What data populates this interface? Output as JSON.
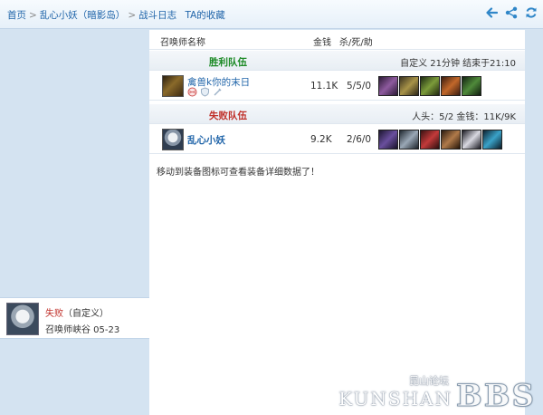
{
  "nav": {
    "crumbs": [
      "首页",
      "乱心小妖（暗影岛）",
      "战斗日志",
      "TA的收藏"
    ],
    "icons": [
      "back-arrow-icon",
      "share-icon",
      "refresh-icon"
    ],
    "accent": "#2f86c8"
  },
  "sidebar": {
    "game": {
      "result": "失败",
      "mode": "（自定义）",
      "map_date": "召唤师峡谷 05-23"
    }
  },
  "table": {
    "headers": {
      "name": "召唤师名称",
      "gold": "金钱",
      "kda": "杀/死/助"
    },
    "win_team": {
      "label": "胜利队伍",
      "info": "自定义 21分钟 结束于21:10",
      "color": "#1c8a26",
      "players": [
        {
          "name": "禽兽k你的末日",
          "gold": "11.1K",
          "kda": "5/5/0"
        }
      ]
    },
    "lose_team": {
      "label": "失败队伍",
      "info": "人头：5/2 金钱：11K/9K",
      "color": "#c0302a",
      "players": [
        {
          "name": "乱心小妖",
          "gold": "9.2K",
          "kda": "2/6/0"
        }
      ]
    },
    "hint": "移动到装备图标可查看装备详细数据了！"
  },
  "watermark": {
    "cn": "昆山论坛",
    "en": "KUNSHAN",
    "bbs": "BBS"
  }
}
